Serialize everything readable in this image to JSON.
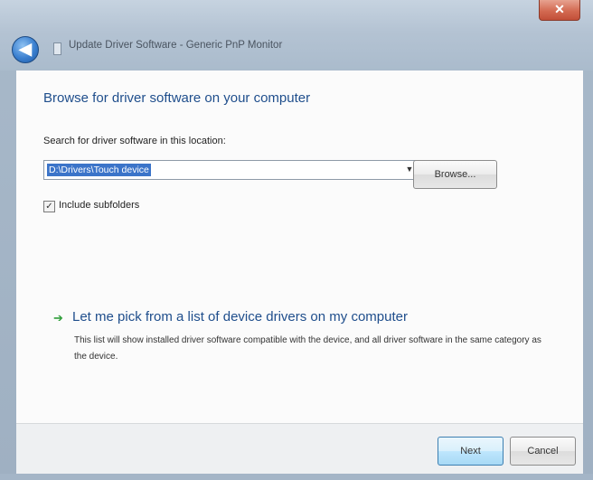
{
  "window": {
    "title": "Update Driver Software - Generic PnP Monitor",
    "close_label": "✕",
    "back_label": "◀"
  },
  "page": {
    "heading": "Browse for driver software on your computer",
    "search_label": "Search for driver software in this location:",
    "path_value": "D:\\Drivers\\Touch device",
    "browse_label": "Browse...",
    "include_subfolders_label": "Include subfolders",
    "include_subfolders_checked": true,
    "pick_title": "Let me pick from a list of device drivers on my computer",
    "pick_description": "This list will show installed driver software compatible with the device, and all driver software in the same category as the device."
  },
  "footer": {
    "next_label": "Next",
    "cancel_label": "Cancel"
  },
  "icons": {
    "back": "back-arrow-icon",
    "title": "device-icon",
    "close": "close-icon",
    "dropdown": "chevron-down-icon",
    "checkbox": "checkmark-icon",
    "pick": "green-arrow-icon"
  },
  "colors": {
    "heading": "#1f4e8c",
    "selection": "#3b74c9",
    "close": "#d36a52",
    "pick_arrow": "#2f9e3a"
  }
}
